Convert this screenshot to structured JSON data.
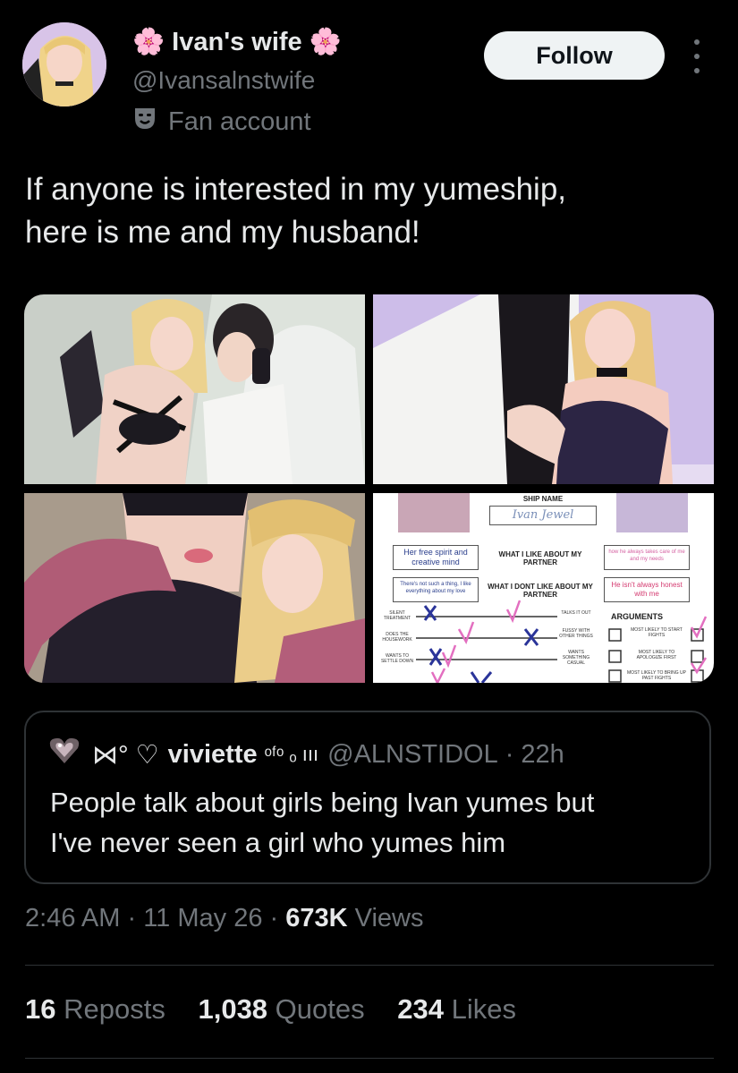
{
  "author": {
    "name_prefix_emoji": "🌸",
    "name": "Ivan's wife",
    "name_suffix_emoji": "🌸",
    "handle": "@Ivansalnstwife",
    "label_icon": "theater-mask-icon",
    "label": "Fan account"
  },
  "follow_label": "Follow",
  "tweet_text_line1": "If anyone is interested in my yumeship,",
  "tweet_text_line2": "here is me and my husband!",
  "media": {
    "chart": {
      "ship_name_label": "SHIP NAME",
      "ship_name": "Ivan Jewel",
      "box_left_1": "Her free spirit and creative mind",
      "center_1": "WHAT I LIKE ABOUT MY PARTNER",
      "box_right_1": "how he always takes care of me and my needs",
      "box_left_2": "There's not such a thing, I like everything about my love",
      "center_2": "WHAT I DONT LIKE ABOUT MY PARTNER",
      "box_right_2": "He isn't always honest with me",
      "arguments": "ARGUMENTS",
      "row1_left": "SILENT TREATMENT",
      "row1_right": "TALKS IT OUT",
      "row2_left": "DOES THE HOUSEWORK",
      "row2_right": "FUSSY WITH OTHER THINGS",
      "row3_left": "WANTS TO SETTLE DOWN",
      "row3_right": "WANTS SOMETHING CASUAL",
      "arg1": "MOST LIKELY TO START FIGHTS",
      "arg2": "MOST LIKELY TO APOLOGIZE FIRST",
      "arg3": "MOST LIKELY TO BRING UP PAST FIGHTS"
    }
  },
  "quote": {
    "avatar_icon": "heart-gem-icon",
    "name_prefix": "⋈° ♡",
    "name": "viviette",
    "name_suffix": "ᵒᶠᵒ ₒ ııı",
    "handle": "@ALNSTIDOL",
    "time": "22h",
    "text_line1": "People talk about girls being Ivan yumes but",
    "text_line2": "I've never seen a girl who yumes him"
  },
  "meta": {
    "time": "2:46 AM",
    "date": "11 May 26",
    "views_count": "673K",
    "views_label": "Views"
  },
  "stats": {
    "reposts_count": "16",
    "reposts_label": "Reposts",
    "quotes_count": "1,038",
    "quotes_label": "Quotes",
    "likes_count": "234",
    "likes_label": "Likes"
  }
}
